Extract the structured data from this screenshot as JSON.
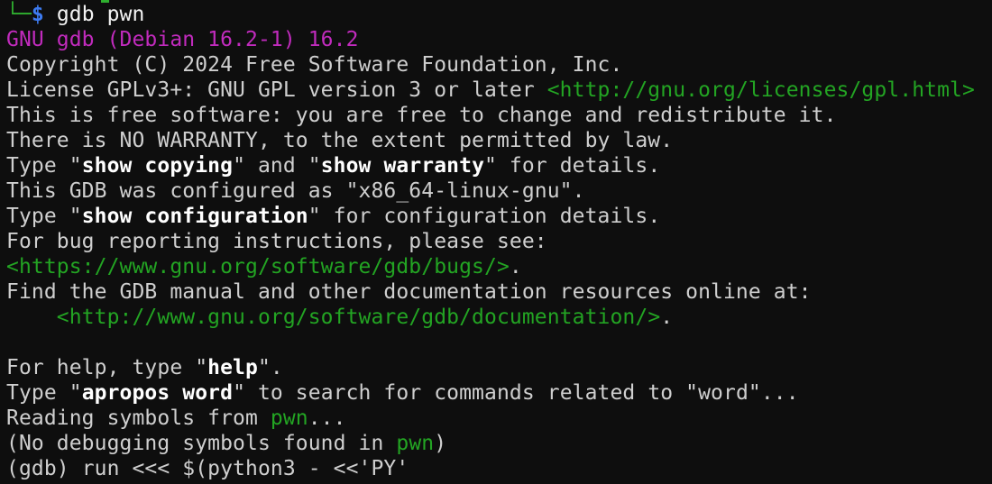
{
  "terminal": {
    "palette": {
      "background": "#0e0e0e",
      "foreground": "#cfcfcf",
      "command_white": "#f2f2f2",
      "bold_white": "#ffffff",
      "green": "#23a423",
      "magenta": "#c12bbd",
      "prompt_green": "#2fae2f",
      "blue": "#3d7bf0"
    },
    "artifact": {
      "name": "previous-line-remnant",
      "color": "prompt_green"
    },
    "lines": [
      {
        "name": "prompt-line",
        "segments": [
          {
            "text": "└─",
            "color": "prompt_green",
            "name": "prompt-corner-icon"
          },
          {
            "text": "$",
            "color": "blue",
            "bold": true,
            "name": "prompt-dollar"
          },
          {
            "text": " ",
            "color": "foreground"
          },
          {
            "text": "gdb pwn",
            "color": "command_white",
            "name": "typed-command"
          }
        ]
      },
      {
        "name": "gdb-version-line",
        "segments": [
          {
            "text": "GNU gdb (Debian 16.2-1) 16.2",
            "color": "magenta",
            "name": "gdb-version-text"
          }
        ]
      },
      {
        "name": "copyright-line",
        "segments": [
          {
            "text": "Copyright (C) 2024 Free Software Foundation, Inc.",
            "color": "foreground"
          }
        ]
      },
      {
        "name": "license-line",
        "segments": [
          {
            "text": "License GPLv3+: GNU GPL version 3 or later ",
            "color": "foreground"
          },
          {
            "text": "<http://gnu.org/licenses/gpl.html>",
            "color": "green",
            "name": "gpl-url-link",
            "interactable": true
          }
        ]
      },
      {
        "name": "free-software-line",
        "segments": [
          {
            "text": "This is free software: you are free to change and redistribute it.",
            "color": "foreground"
          }
        ]
      },
      {
        "name": "warranty-line",
        "segments": [
          {
            "text": "There is NO WARRANTY, to the extent permitted by law.",
            "color": "foreground"
          }
        ]
      },
      {
        "name": "show-copying-line",
        "segments": [
          {
            "text": "Type \"",
            "color": "foreground"
          },
          {
            "text": "show copying",
            "color": "bold_white",
            "bold": true,
            "name": "show-copying-command"
          },
          {
            "text": "\" and \"",
            "color": "foreground"
          },
          {
            "text": "show warranty",
            "color": "bold_white",
            "bold": true,
            "name": "show-warranty-command"
          },
          {
            "text": "\" for details.",
            "color": "foreground"
          }
        ]
      },
      {
        "name": "configured-line",
        "segments": [
          {
            "text": "This GDB was configured as \"x86_64-linux-gnu\".",
            "color": "foreground"
          }
        ]
      },
      {
        "name": "show-configuration-line",
        "segments": [
          {
            "text": "Type \"",
            "color": "foreground"
          },
          {
            "text": "show configuration",
            "color": "bold_white",
            "bold": true,
            "name": "show-configuration-command"
          },
          {
            "text": "\" for configuration details.",
            "color": "foreground"
          }
        ]
      },
      {
        "name": "bug-reporting-line",
        "segments": [
          {
            "text": "For bug reporting instructions, please see:",
            "color": "foreground"
          }
        ]
      },
      {
        "name": "bugs-url-line",
        "segments": [
          {
            "text": "<https://www.gnu.org/software/gdb/bugs/>",
            "color": "green",
            "name": "bugs-url-link",
            "interactable": true
          },
          {
            "text": ".",
            "color": "foreground"
          }
        ]
      },
      {
        "name": "manual-line",
        "segments": [
          {
            "text": "Find the GDB manual and other documentation resources online at:",
            "color": "foreground"
          }
        ]
      },
      {
        "name": "documentation-url-line",
        "segments": [
          {
            "text": "    ",
            "color": "foreground"
          },
          {
            "text": "<http://www.gnu.org/software/gdb/documentation/>",
            "color": "green",
            "name": "documentation-url-link",
            "interactable": true
          },
          {
            "text": ".",
            "color": "foreground"
          }
        ]
      },
      {
        "name": "blank-line",
        "segments": []
      },
      {
        "name": "help-line",
        "segments": [
          {
            "text": "For help, type \"",
            "color": "foreground"
          },
          {
            "text": "help",
            "color": "bold_white",
            "bold": true,
            "name": "help-command"
          },
          {
            "text": "\".",
            "color": "foreground"
          }
        ]
      },
      {
        "name": "apropos-line",
        "segments": [
          {
            "text": "Type \"",
            "color": "foreground"
          },
          {
            "text": "apropos word",
            "color": "bold_white",
            "bold": true,
            "name": "apropos-command"
          },
          {
            "text": "\" to search for commands related to \"word\"...",
            "color": "foreground"
          }
        ]
      },
      {
        "name": "reading-symbols-line",
        "segments": [
          {
            "text": "Reading symbols from ",
            "color": "foreground"
          },
          {
            "text": "pwn",
            "color": "green",
            "name": "binary-name"
          },
          {
            "text": "...",
            "color": "foreground"
          }
        ]
      },
      {
        "name": "no-debug-symbols-line",
        "segments": [
          {
            "text": "(No debugging symbols found in ",
            "color": "foreground"
          },
          {
            "text": "pwn",
            "color": "green",
            "name": "binary-name"
          },
          {
            "text": ")",
            "color": "foreground"
          }
        ]
      },
      {
        "name": "gdb-command-line",
        "segments": [
          {
            "text": "(gdb) ",
            "color": "foreground",
            "name": "gdb-prompt"
          },
          {
            "text": "run <<< $(python3 - <<'PY'",
            "color": "foreground",
            "name": "typed-command"
          }
        ]
      }
    ]
  }
}
